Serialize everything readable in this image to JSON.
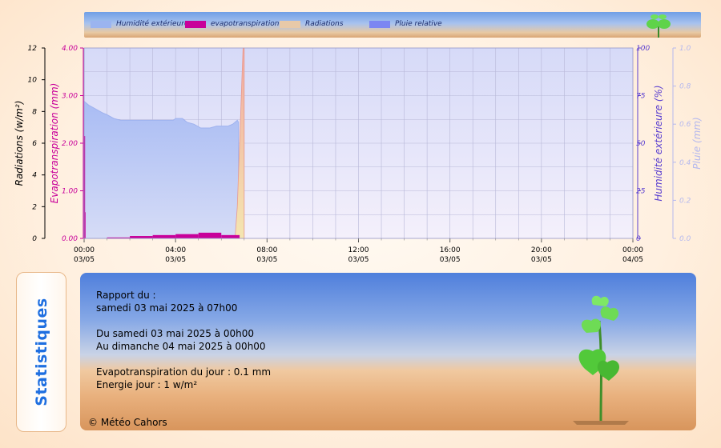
{
  "legend": [
    {
      "label": "Humidité extérieure",
      "color": "#9bb4f0"
    },
    {
      "label": "evapotranspiration",
      "color": "#c8009a"
    },
    {
      "label": "Radiations",
      "color": "#e8c9a8"
    },
    {
      "label": "Pluie relative",
      "color": "#7c86f2"
    }
  ],
  "chart_data": {
    "type": "area",
    "x_tick_labels": [
      [
        "00:00",
        "03/05"
      ],
      [
        "04:00",
        "03/05"
      ],
      [
        "08:00",
        "03/05"
      ],
      [
        "12:00",
        "03/05"
      ],
      [
        "16:00",
        "03/05"
      ],
      [
        "20:00",
        "03/05"
      ],
      [
        "00:00",
        "04/05"
      ]
    ],
    "x_range_hours": [
      0,
      24
    ],
    "axes": {
      "radiations": {
        "label": "Radiations (w/m²)",
        "range": [
          0,
          12
        ],
        "ticks": [
          "0",
          "2",
          "4",
          "6",
          "8",
          "10",
          "12"
        ],
        "color": "#000000"
      },
      "evapotranspiration": {
        "label": "Evapotranspiration (mm)",
        "range": [
          0,
          4
        ],
        "ticks": [
          "0.00",
          "1.00",
          "2.00",
          "3.00",
          "4.00"
        ],
        "color": "#c8009a"
      },
      "humidite": {
        "label": "Humidité extérieure (%)",
        "range": [
          0,
          100
        ],
        "ticks": [
          "0",
          "25",
          "50",
          "75",
          "100"
        ],
        "color": "#5a3fd0"
      },
      "pluie": {
        "label": "Pluie (mm)",
        "range": [
          0,
          1
        ],
        "ticks": [
          "0.0",
          "0.2",
          "0.4",
          "0.6",
          "0.8",
          "1.0"
        ],
        "color": "#b4b8ee"
      }
    },
    "series": [
      {
        "name": "Humidité extérieure",
        "axis": "humidite",
        "color": "#b8c8f6",
        "points": [
          [
            0,
            72
          ],
          [
            0.2,
            70
          ],
          [
            0.5,
            68
          ],
          [
            0.8,
            66
          ],
          [
            1,
            65
          ],
          [
            1.3,
            63
          ],
          [
            1.6,
            62
          ],
          [
            2,
            62
          ],
          [
            2.5,
            62
          ],
          [
            3,
            62
          ],
          [
            3.5,
            62
          ],
          [
            3.9,
            62
          ],
          [
            4,
            63
          ],
          [
            4.3,
            63
          ],
          [
            4.5,
            61
          ],
          [
            4.8,
            60
          ],
          [
            5.1,
            58
          ],
          [
            5.3,
            58
          ],
          [
            5.5,
            58
          ],
          [
            5.8,
            59
          ],
          [
            6,
            59
          ],
          [
            6.3,
            59
          ],
          [
            6.5,
            60
          ],
          [
            6.7,
            62
          ],
          [
            6.75,
            61
          ]
        ]
      },
      {
        "name": "evapotranspiration",
        "axis": "evapotranspiration",
        "color": "#c8009a",
        "bars": [
          [
            0,
            0.02,
            2.15
          ],
          [
            0.02,
            0.06,
            0.55
          ],
          [
            0.06,
            1,
            0.0
          ],
          [
            1,
            2,
            0.02
          ],
          [
            2,
            3,
            0.05
          ],
          [
            3,
            4,
            0.07
          ],
          [
            4,
            5,
            0.09
          ],
          [
            5,
            6,
            0.12
          ],
          [
            6,
            6.8,
            0.07
          ]
        ]
      },
      {
        "name": "Radiations",
        "axis": "radiations",
        "color": "#f0b8b0",
        "points": [
          [
            6.6,
            0
          ],
          [
            6.7,
            2
          ],
          [
            6.8,
            6
          ],
          [
            6.9,
            10
          ],
          [
            6.95,
            12
          ],
          [
            7.0,
            12
          ],
          [
            7.0,
            0
          ]
        ]
      }
    ]
  },
  "stats": {
    "tab_label": "Statistiques",
    "lines": [
      "Rapport du :",
      "samedi 03 mai 2025 à 07h00",
      "",
      "Du samedi 03 mai 2025 à 00h00",
      "Au dimanche 04 mai 2025 à 00h00",
      "",
      "Evapotranspiration du jour : 0.1 mm",
      "Energie jour : 1 w/m²"
    ],
    "copyright": "© Météo Cahors"
  }
}
